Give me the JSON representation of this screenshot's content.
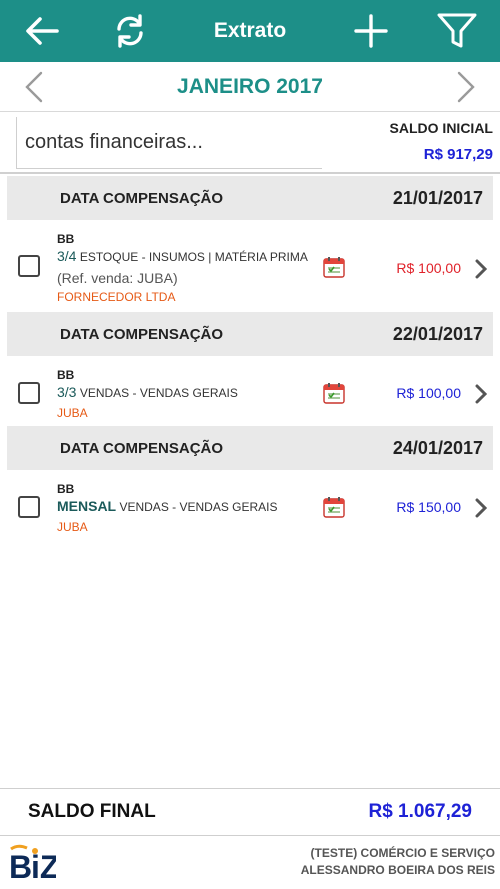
{
  "appbar": {
    "title": "Extrato",
    "back_icon": "arrow-left-icon",
    "refresh_icon": "refresh-icon",
    "add_icon": "plus-icon",
    "filter_icon": "filter-icon",
    "color": "#1d8f88"
  },
  "month_nav": {
    "label": "JANEIRO 2017",
    "prev_icon": "chevron-left-icon",
    "next_icon": "chevron-right-icon"
  },
  "account": {
    "placeholder": "contas financeiras...",
    "saldo_inicial_label": "SALDO INICIAL",
    "saldo_inicial_value": "R$ 917,29"
  },
  "groups": [
    {
      "label": "DATA COMPENSAÇÃO",
      "date": "21/01/2017",
      "entry": {
        "bank": "BB",
        "parcela": "3/4",
        "description": "ESTOQUE - INSUMOS | MATÉRIA PRIMA",
        "reference": "(Ref. venda: JUBA)",
        "party": "FORNECEDOR LTDA",
        "amount": "R$ 100,00",
        "type": "debit"
      }
    },
    {
      "label": "DATA COMPENSAÇÃO",
      "date": "22/01/2017",
      "entry": {
        "bank": "BB",
        "parcela": "3/3",
        "description": "VENDAS - VENDAS GERAIS",
        "party": "JUBA",
        "amount": "R$ 100,00",
        "type": "credit"
      }
    },
    {
      "label": "DATA COMPENSAÇÃO",
      "date": "24/01/2017",
      "entry": {
        "bank": "BB",
        "parcela": "MENSAL",
        "description": "VENDAS - VENDAS GERAIS",
        "party": "JUBA",
        "amount": "R$ 150,00",
        "type": "credit"
      }
    }
  ],
  "footer": {
    "saldo_final_label": "SALDO FINAL",
    "saldo_final_value": "R$ 1.067,29",
    "company_line1": "(TESTE) COMÉRCIO E SERVIÇO",
    "company_line2": "ALESSANDRO BOEIRA DOS REIS",
    "logo_text": "BIZ"
  },
  "colors": {
    "accent": "#1d8f88",
    "debit": "#e0222a",
    "credit": "#1e22d6",
    "party": "#e65a16"
  }
}
